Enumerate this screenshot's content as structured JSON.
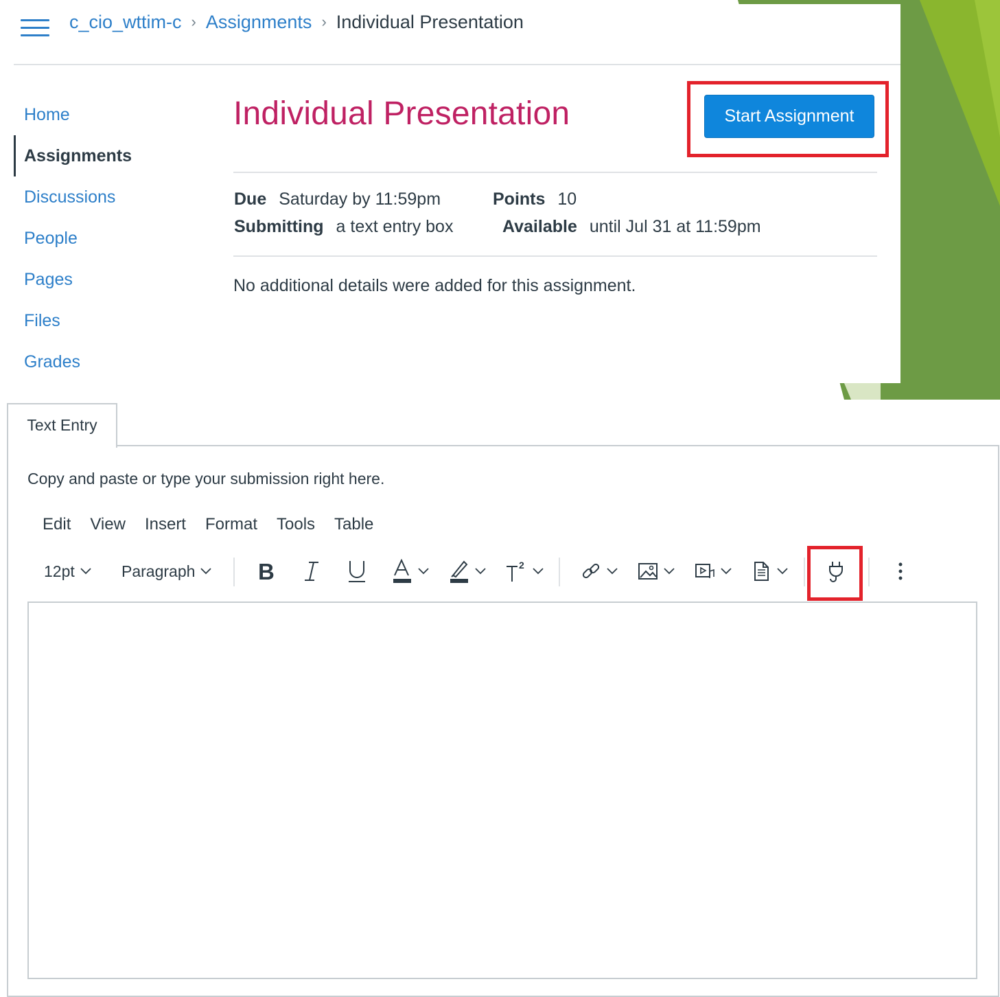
{
  "breadcrumb": {
    "course": "c_cio_wttim-c",
    "section": "Assignments",
    "current": "Individual Presentation"
  },
  "nav": {
    "items": [
      {
        "label": "Home",
        "active": false
      },
      {
        "label": "Assignments",
        "active": true
      },
      {
        "label": "Discussions",
        "active": false
      },
      {
        "label": "People",
        "active": false
      },
      {
        "label": "Pages",
        "active": false
      },
      {
        "label": "Files",
        "active": false
      },
      {
        "label": "Grades",
        "active": false
      }
    ]
  },
  "assignment": {
    "title": "Individual Presentation",
    "start_button": "Start Assignment",
    "due_label": "Due",
    "due_value": "Saturday by 11:59pm",
    "points_label": "Points",
    "points_value": "10",
    "submitting_label": "Submitting",
    "submitting_value": "a text entry box",
    "available_label": "Available",
    "available_value": "until Jul 31 at 11:59pm",
    "description": "No additional details were added for this assignment."
  },
  "submission": {
    "tab_label": "Text Entry",
    "instructions": "Copy and paste or type your submission right here.",
    "menu": [
      "Edit",
      "View",
      "Insert",
      "Format",
      "Tools",
      "Table"
    ],
    "font_size": "12pt",
    "block_format": "Paragraph",
    "editor_content": ""
  },
  "colors": {
    "link": "#2d7fc9",
    "title": "#bf2163",
    "button": "#0f86dc",
    "highlight": "#e3222b",
    "deco_green": "#6a9a41"
  }
}
